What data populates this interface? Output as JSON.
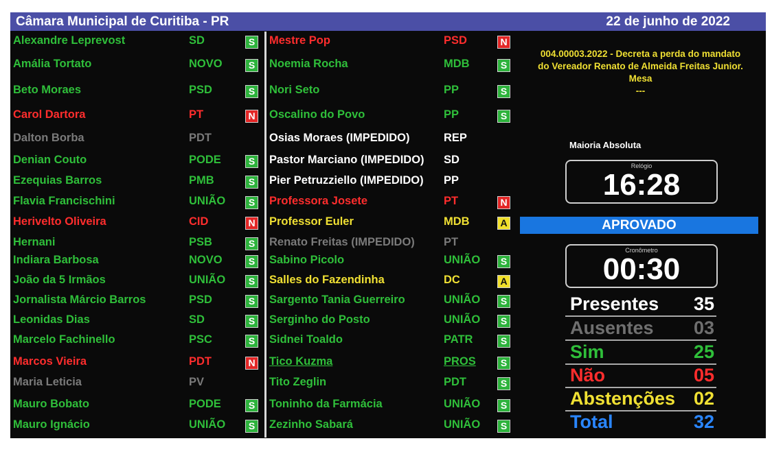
{
  "header": {
    "title": "Câmara Municipal de Curitiba - PR",
    "date": "22 de junho de 2022"
  },
  "left_column": [
    {
      "name": "Alexandre Leprevost",
      "party": "SD",
      "vote": "S",
      "color": "green"
    },
    {
      "name": "Amália Tortato",
      "party": "NOVO",
      "vote": "S",
      "color": "green"
    },
    {
      "name": "Beto Moraes",
      "party": "PSD",
      "vote": "S",
      "color": "green"
    },
    {
      "name": "Carol Dartora",
      "party": "PT",
      "vote": "N",
      "color": "red"
    },
    {
      "name": "Dalton Borba",
      "party": "PDT",
      "vote": "",
      "color": "gray"
    },
    {
      "name": "Denian Couto",
      "party": "PODE",
      "vote": "S",
      "color": "green"
    },
    {
      "name": "Ezequias Barros",
      "party": "PMB",
      "vote": "S",
      "color": "green"
    },
    {
      "name": "Flavia Francischini",
      "party": "UNIÃO",
      "vote": "S",
      "color": "green"
    },
    {
      "name": "Herivelto Oliveira",
      "party": "CID",
      "vote": "N",
      "color": "red"
    },
    {
      "name": "Hernani",
      "party": "PSB",
      "vote": "S",
      "color": "green"
    },
    {
      "name": "Indiara Barbosa",
      "party": "NOVO",
      "vote": "S",
      "color": "green"
    },
    {
      "name": "João da 5 Irmãos",
      "party": "UNIÃO",
      "vote": "S",
      "color": "green"
    },
    {
      "name": "Jornalista Márcio Barros",
      "party": "PSD",
      "vote": "S",
      "color": "green"
    },
    {
      "name": "Leonidas Dias",
      "party": "SD",
      "vote": "S",
      "color": "green"
    },
    {
      "name": "Marcelo Fachinello",
      "party": "PSC",
      "vote": "S",
      "color": "green"
    },
    {
      "name": "Marcos Vieira",
      "party": "PDT",
      "vote": "N",
      "color": "red"
    },
    {
      "name": "Maria Leticia",
      "party": "PV",
      "vote": "",
      "color": "gray"
    },
    {
      "name": "Mauro Bobato",
      "party": "PODE",
      "vote": "S",
      "color": "green"
    },
    {
      "name": "Mauro Ignácio",
      "party": "UNIÃO",
      "vote": "S",
      "color": "green"
    }
  ],
  "right_column": [
    {
      "name": "Mestre Pop",
      "party": "PSD",
      "vote": "N",
      "color": "red"
    },
    {
      "name": "Noemia Rocha",
      "party": "MDB",
      "vote": "S",
      "color": "green"
    },
    {
      "name": "Nori Seto",
      "party": "PP",
      "vote": "S",
      "color": "green"
    },
    {
      "name": "Oscalino do Povo",
      "party": "PP",
      "vote": "S",
      "color": "green"
    },
    {
      "name": "Osias Moraes (IMPEDIDO)",
      "party": "REP",
      "vote": "",
      "color": "white"
    },
    {
      "name": "Pastor Marciano (IMPEDIDO)",
      "party": "SD",
      "vote": "",
      "color": "white"
    },
    {
      "name": "Pier Petruzziello (IMPEDIDO)",
      "party": "PP",
      "vote": "",
      "color": "white"
    },
    {
      "name": "Professora Josete",
      "party": "PT",
      "vote": "N",
      "color": "red"
    },
    {
      "name": "Professor Euler",
      "party": "MDB",
      "vote": "A",
      "color": "yellow"
    },
    {
      "name": "Renato Freitas (IMPEDIDO)",
      "party": "PT",
      "vote": "",
      "color": "gray"
    },
    {
      "name": "Sabino Picolo",
      "party": "UNIÃO",
      "vote": "S",
      "color": "green"
    },
    {
      "name": "Salles do Fazendinha",
      "party": "DC",
      "vote": "A",
      "color": "yellow"
    },
    {
      "name": "Sargento Tania Guerreiro",
      "party": "UNIÃO",
      "vote": "S",
      "color": "green"
    },
    {
      "name": "Serginho do Posto",
      "party": "UNIÃO",
      "vote": "S",
      "color": "green"
    },
    {
      "name": "Sidnei Toaldo",
      "party": "PATR",
      "vote": "S",
      "color": "green"
    },
    {
      "name": "Tico Kuzma",
      "party": "PROS",
      "vote": "S",
      "color": "green",
      "underline": true
    },
    {
      "name": "Tito Zeglin",
      "party": "PDT",
      "vote": "S",
      "color": "green"
    },
    {
      "name": "Toninho da Farmácia",
      "party": "UNIÃO",
      "vote": "S",
      "color": "green"
    },
    {
      "name": "Zezinho Sabará",
      "party": "UNIÃO",
      "vote": "S",
      "color": "green"
    }
  ],
  "motion": {
    "line1": "004.00003.2022 - Decreta a perda do mandato",
    "line2": "do Vereador Renato de Almeida Freitas Junior.",
    "line3": "Mesa",
    "line4": "---"
  },
  "majority_label": "Maioria Absoluta",
  "clock": {
    "label": "Relógio",
    "value": "16:28"
  },
  "result": "APROVADO",
  "timer": {
    "label": "Cronômetro",
    "value": "00:30"
  },
  "stats": [
    {
      "label": "Presentes",
      "value": "35",
      "color": "#ffffff"
    },
    {
      "label": "Ausentes",
      "value": "03",
      "color": "#6f6f6f"
    },
    {
      "label": "Sim",
      "value": "25",
      "color": "#2fbf3a"
    },
    {
      "label": "Não",
      "value": "05",
      "color": "#ff2d2d"
    },
    {
      "label": "Abstenções",
      "value": "02",
      "color": "#f0e033"
    },
    {
      "label": "Total",
      "value": "32",
      "color": "#2a86ff"
    }
  ],
  "colors": {
    "green": "#2fbf3a",
    "red": "#ff2d2d",
    "gray": "#7a7a7a",
    "white": "#ffffff",
    "yellow": "#f0e033",
    "header": "#4b4fa6",
    "result": "#1976e0"
  }
}
